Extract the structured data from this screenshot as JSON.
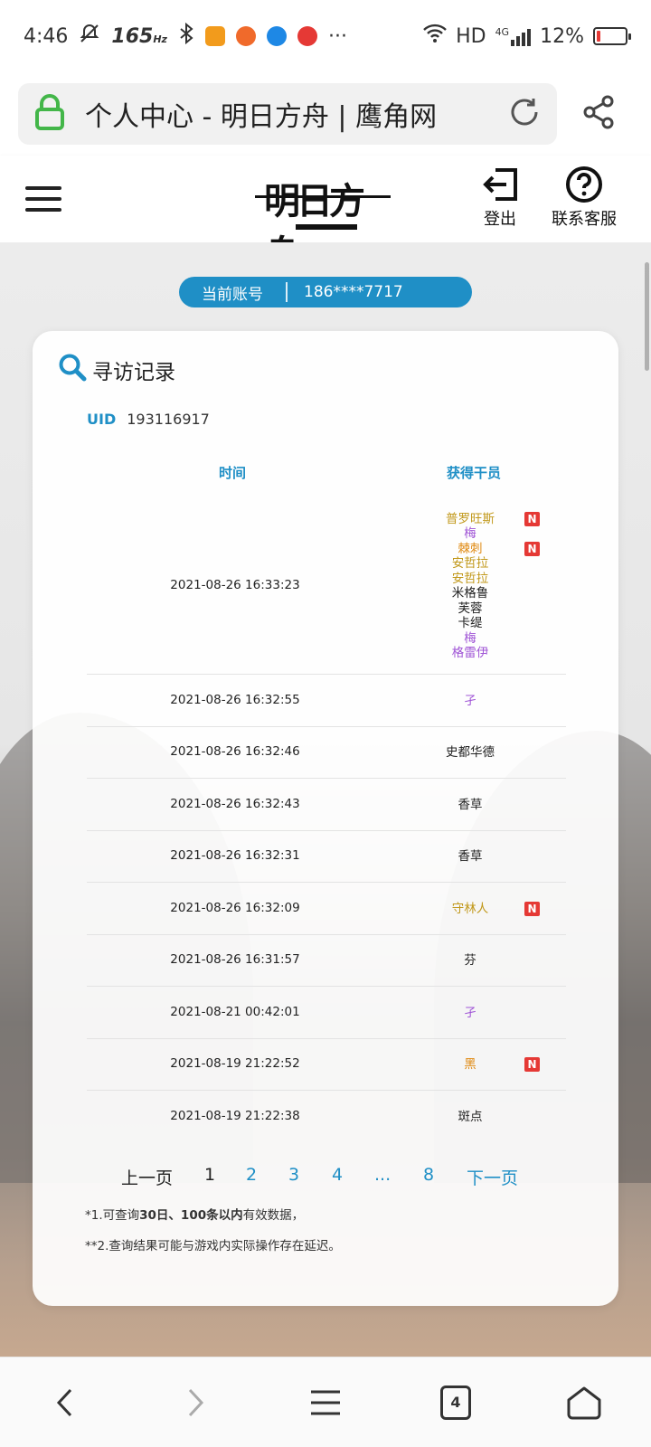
{
  "status_bar": {
    "time": "4:46",
    "refresh_rate": "165",
    "refresh_unit": "Hz",
    "more": "···",
    "network": "HD",
    "signal_type": "4G",
    "battery": "12%"
  },
  "browser": {
    "page_title": "个人中心 - 明日方舟 | 鹰角网",
    "tab_count": "4"
  },
  "header": {
    "logo_text": "明日方舟",
    "logout_label": "登出",
    "support_label": "联系客服"
  },
  "account": {
    "label": "当前账号",
    "value": "186****7717"
  },
  "card": {
    "title": "寻访记录",
    "uid_label": "UID",
    "uid_value": "193116917",
    "col_time": "时间",
    "col_operator": "获得干员"
  },
  "colors": {
    "accent": "#1f8fc6",
    "new_badge": "#e53935",
    "rarity_6": "#e08a13",
    "rarity_5": "#c1981a",
    "rarity_4": "#a055d6",
    "rarity_3": "#222222"
  },
  "records": [
    {
      "time": "2021-08-26 16:33:23",
      "operators": [
        {
          "name": "普罗旺斯",
          "color": "#c1981a",
          "new": "N"
        },
        {
          "name": "梅",
          "color": "#a055d6"
        },
        {
          "name": "棘刺",
          "color": "#e08a13",
          "new": "N"
        },
        {
          "name": "安哲拉",
          "color": "#c1981a"
        },
        {
          "name": "安哲拉",
          "color": "#c1981a"
        },
        {
          "name": "米格鲁",
          "color": "#222222"
        },
        {
          "name": "芙蓉",
          "color": "#222222"
        },
        {
          "name": "卡缇",
          "color": "#222222"
        },
        {
          "name": "梅",
          "color": "#a055d6"
        },
        {
          "name": "格雷伊",
          "color": "#a055d6"
        }
      ]
    },
    {
      "time": "2021-08-26 16:32:55",
      "operators": [
        {
          "name": "孑",
          "color": "#a055d6"
        }
      ]
    },
    {
      "time": "2021-08-26 16:32:46",
      "operators": [
        {
          "name": "史都华德",
          "color": "#222222"
        }
      ]
    },
    {
      "time": "2021-08-26 16:32:43",
      "operators": [
        {
          "name": "香草",
          "color": "#222222"
        }
      ]
    },
    {
      "time": "2021-08-26 16:32:31",
      "operators": [
        {
          "name": "香草",
          "color": "#222222"
        }
      ]
    },
    {
      "time": "2021-08-26 16:32:09",
      "operators": [
        {
          "name": "守林人",
          "color": "#c1981a",
          "new": "N"
        }
      ]
    },
    {
      "time": "2021-08-26 16:31:57",
      "operators": [
        {
          "name": "芬",
          "color": "#222222"
        }
      ]
    },
    {
      "time": "2021-08-21 00:42:01",
      "operators": [
        {
          "name": "孑",
          "color": "#a055d6"
        }
      ]
    },
    {
      "time": "2021-08-19 21:22:52",
      "operators": [
        {
          "name": "黑",
          "color": "#e08a13",
          "new": "N"
        }
      ]
    },
    {
      "time": "2021-08-19 21:22:38",
      "operators": [
        {
          "name": "斑点",
          "color": "#222222"
        }
      ]
    }
  ],
  "pagination": {
    "prev": "上一页",
    "pages": [
      "1",
      "2",
      "3",
      "4",
      "...",
      "8"
    ],
    "current": "1",
    "next": "下一页"
  },
  "footnotes": {
    "note1_prefix": "*1.可查询",
    "note1_bold": "30日、100条以内",
    "note1_suffix": "有效数据，",
    "note2": "**2.查询结果可能与游戏内实际操作存在延迟。"
  }
}
